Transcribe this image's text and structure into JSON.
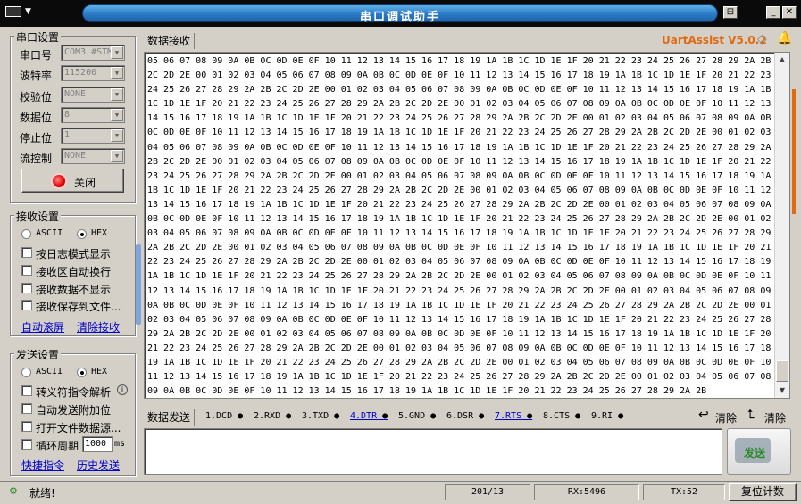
{
  "window": {
    "title": "串口调试助手",
    "version": "UartAssist V5.0.2"
  },
  "serial_settings": {
    "group_title": "串口设置",
    "port_label": "串口号",
    "port_value": "COM3 #STM",
    "baud_label": "波特率",
    "baud_value": "115200",
    "parity_label": "校验位",
    "parity_value": "NONE",
    "databits_label": "数据位",
    "databits_value": "8",
    "stopbits_label": "停止位",
    "stopbits_value": "1",
    "flow_label": "流控制",
    "flow_value": "NONE",
    "open_close_label": "关闭"
  },
  "receive_settings": {
    "group_title": "接收设置",
    "ascii_label": "ASCII",
    "hex_label": "HEX",
    "mode_selected": "HEX",
    "log_mode_label": "按日志模式显示",
    "auto_newline_label": "接收区自动换行",
    "hide_data_label": "接收数据不显示",
    "save_to_file_label": "接收保存到文件...",
    "auto_clear_link": "自动滚屏",
    "clear_recv_link": "清除接收"
  },
  "send_settings": {
    "group_title": "发送设置",
    "ascii_label": "ASCII",
    "hex_label": "HEX",
    "mode_selected": "HEX",
    "escape_label": "转义符指令解析",
    "auto_append_label": "自动发送附加位",
    "open_file_label": "打开文件数据源...",
    "cycle_label": "循环周期",
    "cycle_value": "1000",
    "cycle_unit": "ms",
    "quick_cmd_link": "快捷指令",
    "history_link": "历史发送"
  },
  "receive_panel": {
    "tab_label": "数据接收",
    "lines": [
      "05 06 07 08 09 0A 0B 0C 0D 0E 0F 10 11 12 13 14 15 16 17 18 19 1A 1B 1C 1D 1E 1F 20 21 22 23 24 25 26 27 28 29 2A 2B",
      "2C 2D 2E 00 01 02 03 04 05 06 07 08 09 0A 0B 0C 0D 0E 0F 10 11 12 13 14 15 16 17 18 19 1A 1B 1C 1D 1E 1F 20 21 22 23",
      "24 25 26 27 28 29 2A 2B 2C 2D 2E 00 01 02 03 04 05 06 07 08 09 0A 0B 0C 0D 0E 0F 10 11 12 13 14 15 16 17 18 19 1A 1B",
      "1C 1D 1E 1F 20 21 22 23 24 25 26 27 28 29 2A 2B 2C 2D 2E 00 01 02 03 04 05 06 07 08 09 0A 0B 0C 0D 0E 0F 10 11 12 13",
      "14 15 16 17 18 19 1A 1B 1C 1D 1E 1F 20 21 22 23 24 25 26 27 28 29 2A 2B 2C 2D 2E 00 01 02 03 04 05 06 07 08 09 0A 0B",
      "0C 0D 0E 0F 10 11 12 13 14 15 16 17 18 19 1A 1B 1C 1D 1E 1F 20 21 22 23 24 25 26 27 28 29 2A 2B 2C 2D 2E 00 01 02 03",
      "04 05 06 07 08 09 0A 0B 0C 0D 0E 0F 10 11 12 13 14 15 16 17 18 19 1A 1B 1C 1D 1E 1F 20 21 22 23 24 25 26 27 28 29 2A",
      "2B 2C 2D 2E 00 01 02 03 04 05 06 07 08 09 0A 0B 0C 0D 0E 0F 10 11 12 13 14 15 16 17 18 19 1A 1B 1C 1D 1E 1F 20 21 22",
      "23 24 25 26 27 28 29 2A 2B 2C 2D 2E 00 01 02 03 04 05 06 07 08 09 0A 0B 0C 0D 0E 0F 10 11 12 13 14 15 16 17 18 19 1A",
      "1B 1C 1D 1E 1F 20 21 22 23 24 25 26 27 28 29 2A 2B 2C 2D 2E 00 01 02 03 04 05 06 07 08 09 0A 0B 0C 0D 0E 0F 10 11 12",
      "13 14 15 16 17 18 19 1A 1B 1C 1D 1E 1F 20 21 22 23 24 25 26 27 28 29 2A 2B 2C 2D 2E 00 01 02 03 04 05 06 07 08 09 0A",
      "0B 0C 0D 0E 0F 10 11 12 13 14 15 16 17 18 19 1A 1B 1C 1D 1E 1F 20 21 22 23 24 25 26 27 28 29 2A 2B 2C 2D 2E 00 01 02",
      "03 04 05 06 07 08 09 0A 0B 0C 0D 0E 0F 10 11 12 13 14 15 16 17 18 19 1A 1B 1C 1D 1E 1F 20 21 22 23 24 25 26 27 28 29",
      "2A 2B 2C 2D 2E 00 01 02 03 04 05 06 07 08 09 0A 0B 0C 0D 0E 0F 10 11 12 13 14 15 16 17 18 19 1A 1B 1C 1D 1E 1F 20 21",
      "22 23 24 25 26 27 28 29 2A 2B 2C 2D 2E 00 01 02 03 04 05 06 07 08 09 0A 0B 0C 0D 0E 0F 10 11 12 13 14 15 16 17 18 19",
      "1A 1B 1C 1D 1E 1F 20 21 22 23 24 25 26 27 28 29 2A 2B 2C 2D 2E 00 01 02 03 04 05 06 07 08 09 0A 0B 0C 0D 0E 0F 10 11",
      "12 13 14 15 16 17 18 19 1A 1B 1C 1D 1E 1F 20 21 22 23 24 25 26 27 28 29 2A 2B 2C 2D 2E 00 01 02 03 04 05 06 07 08 09",
      "0A 0B 0C 0D 0E 0F 10 11 12 13 14 15 16 17 18 19 1A 1B 1C 1D 1E 1F 20 21 22 23 24 25 26 27 28 29 2A 2B 2C 2D 2E 00 01",
      "02 03 04 05 06 07 08 09 0A 0B 0C 0D 0E 0F 10 11 12 13 14 15 16 17 18 19 1A 1B 1C 1D 1E 1F 20 21 22 23 24 25 26 27 28",
      "29 2A 2B 2C 2D 2E 00 01 02 03 04 05 06 07 08 09 0A 0B 0C 0D 0E 0F 10 11 12 13 14 15 16 17 18 19 1A 1B 1C 1D 1E 1F 20",
      "21 22 23 24 25 26 27 28 29 2A 2B 2C 2D 2E 00 01 02 03 04 05 06 07 08 09 0A 0B 0C 0D 0E 0F 10 11 12 13 14 15 16 17 18",
      "19 1A 1B 1C 1D 1E 1F 20 21 22 23 24 25 26 27 28 29 2A 2B 2C 2D 2E 00 01 02 03 04 05 06 07 08 09 0A 0B 0C 0D 0E 0F 10",
      "11 12 13 14 15 16 17 18 19 1A 1B 1C 1D 1E 1F 20 21 22 23 24 25 26 27 28 29 2A 2B 2C 2D 2E 00 01 02 03 04 05 06 07 08",
      "09 0A 0B 0C 0D 0E 0F 10 11 12 13 14 15 16 17 18 19 1A 1B 1C 1D 1E 1F 20 21 22 23 24 25 26 27 28 29 2A 2B"
    ]
  },
  "send_panel": {
    "tab_label": "数据发送",
    "pins": [
      {
        "label": "1.DCD",
        "link": false
      },
      {
        "label": "2.RXD",
        "link": false
      },
      {
        "label": "3.TXD",
        "link": false
      },
      {
        "label": "4.DTR",
        "link": true
      },
      {
        "label": "5.GND",
        "link": false
      },
      {
        "label": "6.DSR",
        "link": false
      },
      {
        "label": "7.RTS",
        "link": true
      },
      {
        "label": "8.CTS",
        "link": false
      },
      {
        "label": "9.RI",
        "link": false
      }
    ],
    "clear1_label": "清除",
    "clear2_label": "清除",
    "send_button_label": "发送"
  },
  "status_bar": {
    "status_text": "就绪!",
    "progress": "201/13",
    "rx": "RX:5496",
    "tx": "TX:52",
    "reset_label": "复位计数"
  },
  "colors": {
    "accent": "#e06a10",
    "title_bar": "#2a7ac6",
    "link": "#0000cc",
    "send_green": "#2a8a2a"
  }
}
